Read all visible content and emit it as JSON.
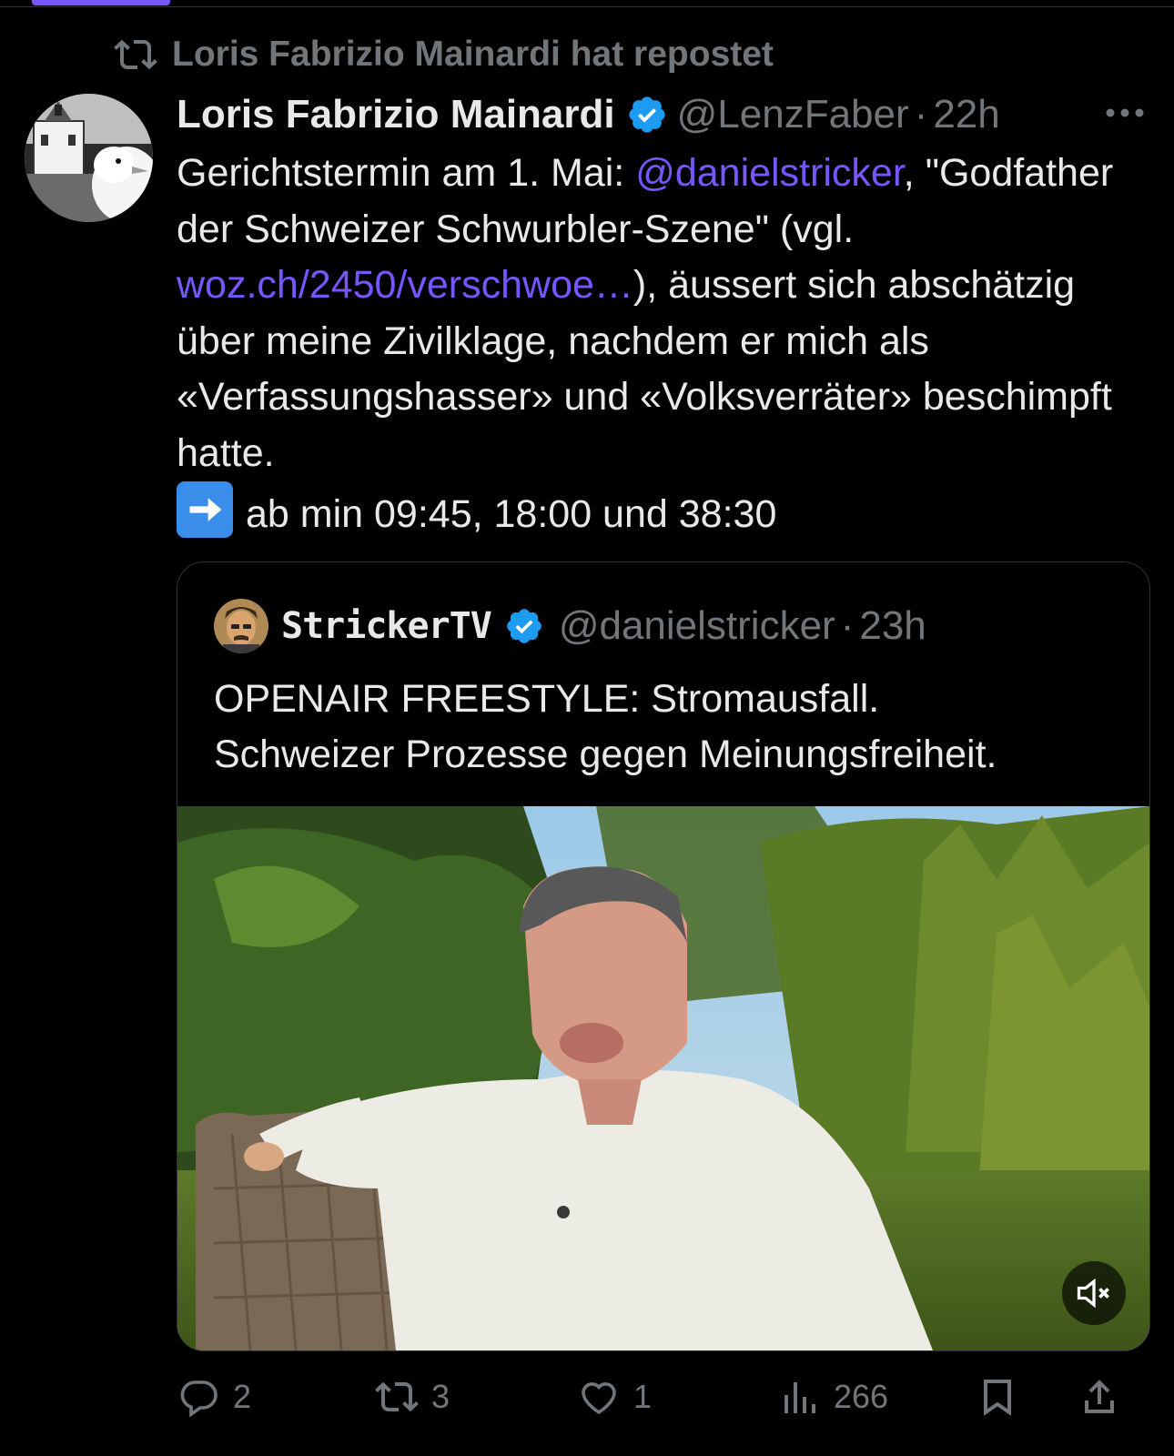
{
  "repost": {
    "text": "Loris Fabrizio Mainardi hat repostet",
    "icon": "repost-icon"
  },
  "tweet": {
    "author_name": "Loris Fabrizio Mainardi",
    "handle": "@LenzFaber",
    "separator": "·",
    "time": "22h",
    "text": {
      "part1": "Gerichtstermin am 1. Mai: ",
      "mention": "@danielstricker",
      "part2": ", \"Godfather der Schweizer Schwurbler-Szene\" (vgl. ",
      "link": "woz.ch/2450/verschwoe…",
      "part3": "), äussert sich abschätzig über meine Zivilklage, nachdem er mich als «Verfassungshasser» und «Volksverräter» beschimpft hatte.",
      "part4": "ab min 09:45, 18:00 und 38:30"
    }
  },
  "quote": {
    "author_name": "StrickerTV",
    "handle": "@danielstricker",
    "separator": "·",
    "time": "23h",
    "text_line1": "OPENAIR FREESTYLE: Stromausfall.",
    "text_line2": "Schweizer Prozesse gegen Meinungsfreiheit."
  },
  "actions": {
    "replies": "2",
    "reposts": "3",
    "likes": "1",
    "views": "266"
  },
  "colors": {
    "accent": "#7856ff",
    "verified": "#1d9bf0",
    "muted": "#71767b",
    "text": "#e7e9ea",
    "background": "#000000"
  }
}
